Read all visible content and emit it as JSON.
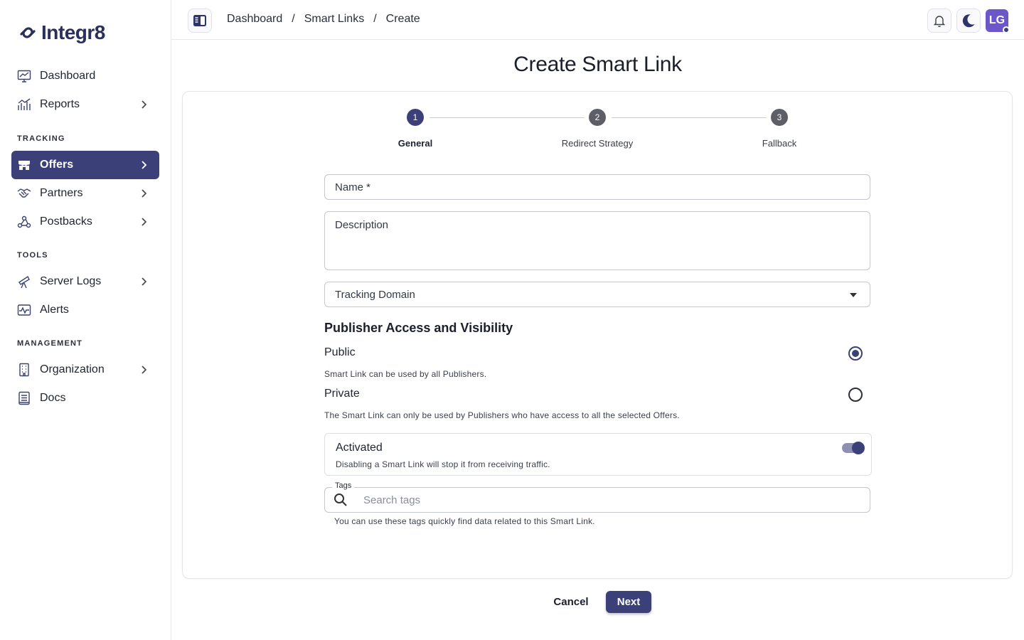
{
  "app": {
    "name": "Integr8"
  },
  "sidebar": {
    "items_top": [
      {
        "label": "Dashboard",
        "icon": "dashboard-chart-icon"
      },
      {
        "label": "Reports",
        "icon": "bar-chart-icon"
      }
    ],
    "sections": [
      {
        "label": "TRACKING",
        "items": [
          {
            "label": "Offers",
            "icon": "storefront-icon",
            "active": true
          },
          {
            "label": "Partners",
            "icon": "handshake-icon"
          },
          {
            "label": "Postbacks",
            "icon": "webhook-icon"
          }
        ]
      },
      {
        "label": "TOOLS",
        "items": [
          {
            "label": "Server Logs",
            "icon": "telescope-icon"
          },
          {
            "label": "Alerts",
            "icon": "activity-alert-icon"
          }
        ]
      },
      {
        "label": "MANAGEMENT",
        "items": [
          {
            "label": "Organization",
            "icon": "building-icon"
          },
          {
            "label": "Docs",
            "icon": "document-icon"
          }
        ]
      }
    ]
  },
  "header": {
    "breadcrumb": [
      "Dashboard",
      "Smart Links",
      "Create"
    ],
    "separator": "/",
    "avatar_initials": "LG"
  },
  "page": {
    "title": "Create Smart Link"
  },
  "stepper": {
    "steps": [
      {
        "number": "1",
        "label": "General",
        "active": true
      },
      {
        "number": "2",
        "label": "Redirect Strategy",
        "active": false
      },
      {
        "number": "3",
        "label": "Fallback",
        "active": false
      }
    ]
  },
  "form": {
    "name": {
      "placeholder": "Name *",
      "value": ""
    },
    "description": {
      "placeholder": "Description",
      "value": ""
    },
    "tracking_domain": {
      "placeholder": "Tracking Domain",
      "value": ""
    },
    "visibility": {
      "title": "Publisher Access and Visibility",
      "options": [
        {
          "label": "Public",
          "help": "Smart Link can be used by all Publishers.",
          "selected": true
        },
        {
          "label": "Private",
          "help": "The Smart Link can only be used by Publishers who have access to all the selected Offers.",
          "selected": false
        }
      ]
    },
    "activated": {
      "title": "Activated",
      "help": "Disabling a Smart Link will stop it from receiving traffic.",
      "on": true
    },
    "tags": {
      "legend": "Tags",
      "placeholder": "Search tags",
      "help": "You can use these tags quickly find data related to this Smart Link."
    }
  },
  "actions": {
    "cancel": "Cancel",
    "next": "Next"
  },
  "colors": {
    "accent": "#3b4178",
    "avatar": "#6b57c9"
  }
}
